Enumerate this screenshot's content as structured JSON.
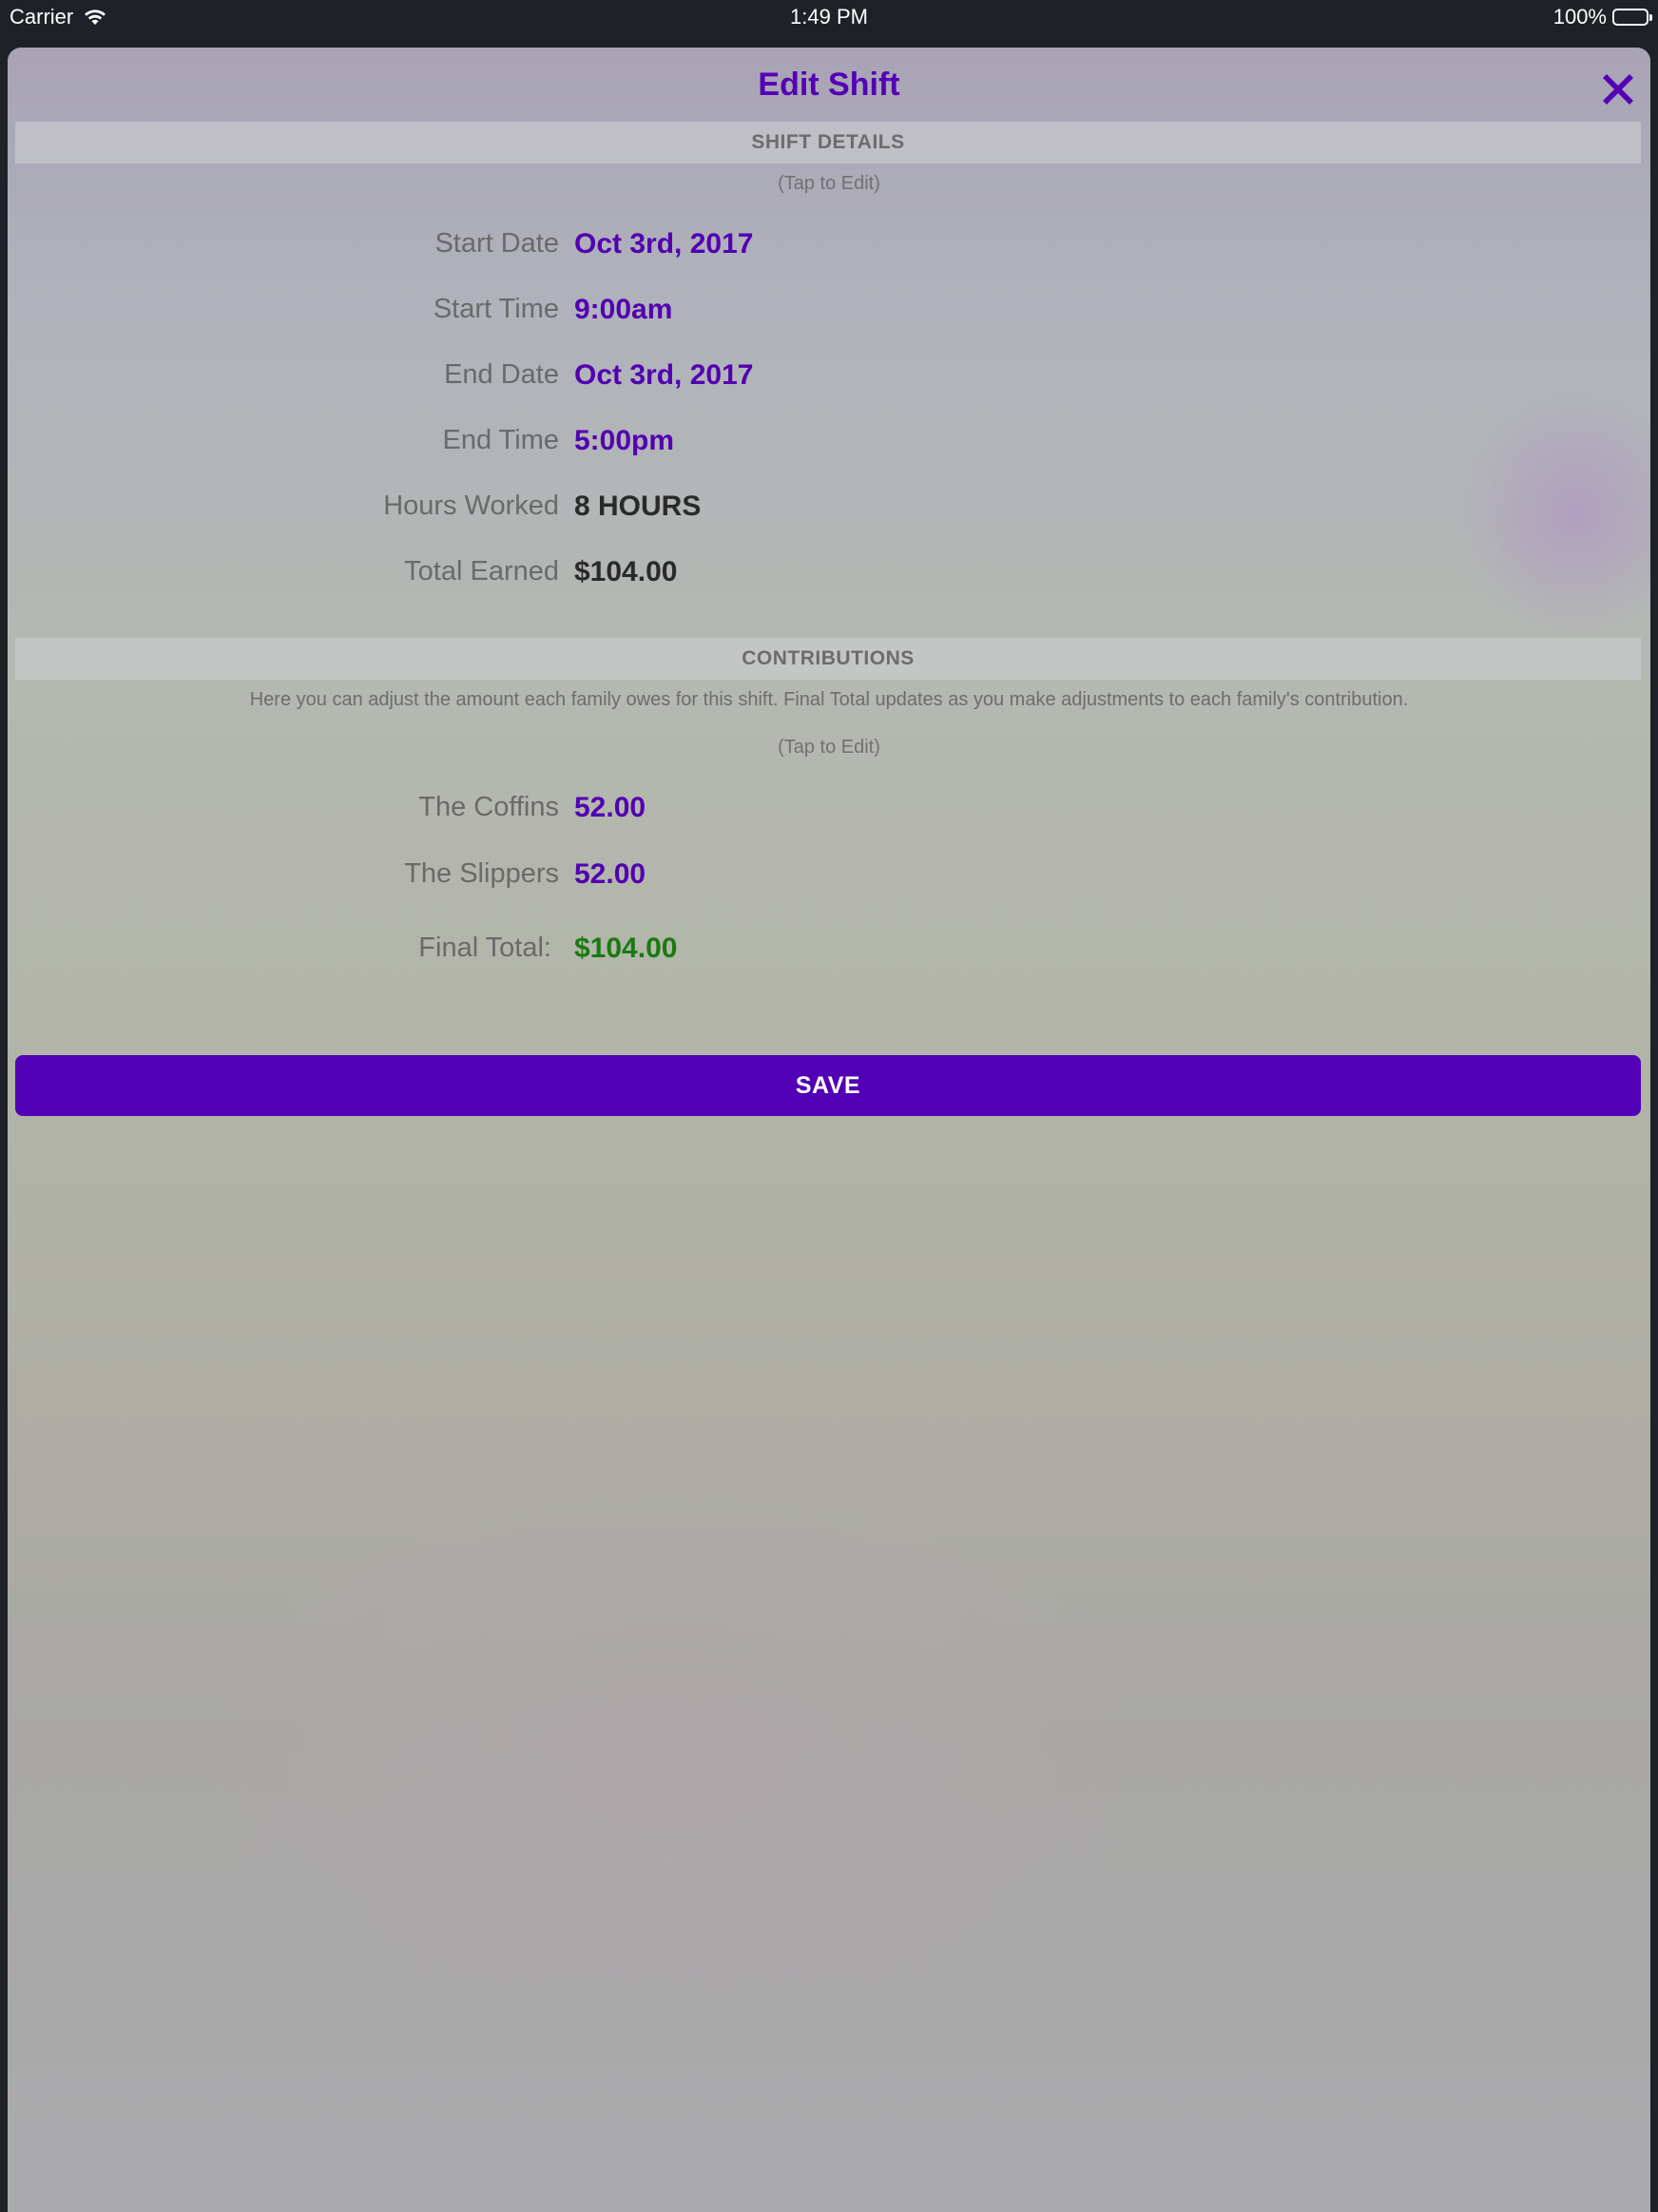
{
  "status_bar": {
    "carrier": "Carrier",
    "time": "1:49 PM",
    "battery": "100%"
  },
  "modal": {
    "title": "Edit Shift",
    "close_icon": "close-x-icon"
  },
  "shift_details": {
    "header": "SHIFT DETAILS",
    "tap_hint": "(Tap to Edit)",
    "rows": [
      {
        "label": "Start Date",
        "value": "Oct 3rd, 2017"
      },
      {
        "label": "Start Time",
        "value": "9:00am"
      },
      {
        "label": "End Date",
        "value": "Oct 3rd, 2017"
      },
      {
        "label": "End Time",
        "value": "5:00pm"
      },
      {
        "label": "Hours Worked",
        "value": "8 HOURS"
      },
      {
        "label": "Total Earned",
        "value": "$104.00"
      }
    ]
  },
  "contributions": {
    "header": "CONTRIBUTIONS",
    "note": "Here you can adjust the amount each family owes for this shift. Final Total updates as you make adjustments to each family's contribution.",
    "tap_hint": "(Tap to Edit)",
    "families": [
      {
        "label": "The Coffins",
        "value": "52.00"
      },
      {
        "label": "The Slippers",
        "value": "52.00"
      }
    ],
    "final_total_label": "Final Total:",
    "final_total_value": "$104.00"
  },
  "save_label": "SAVE",
  "colors": {
    "accent": "#5200b5",
    "total_green": "#1a7a10"
  }
}
